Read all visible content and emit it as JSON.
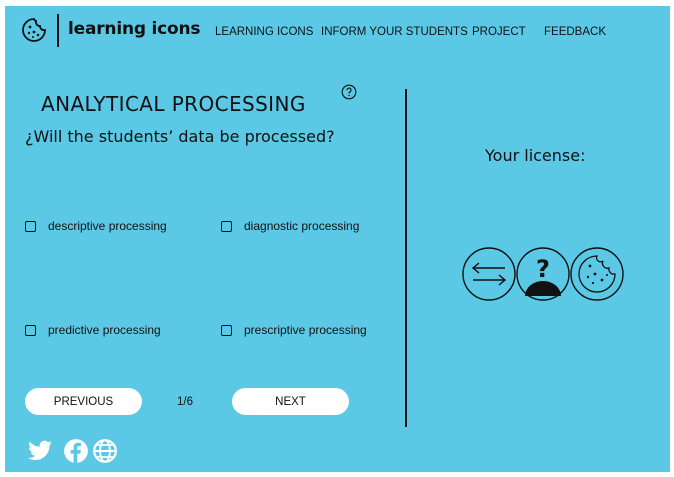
{
  "header": {
    "brand": "learning icons",
    "logo_icon": "cookie-icon",
    "nav": [
      {
        "label": "LEARNING ICONS"
      },
      {
        "label": "INFORM YOUR STUDENTS"
      },
      {
        "label": "PROJECT"
      },
      {
        "label": "FEEDBACK"
      }
    ]
  },
  "step": {
    "title": "ANALYTICAL PROCESSING",
    "help_icon": "question-circle-icon",
    "question": "¿Will the students’ data be processed?",
    "options": [
      {
        "label": "descriptive processing",
        "checked": false
      },
      {
        "label": "diagnostic processing",
        "checked": false
      },
      {
        "label": "predictive processing",
        "checked": false
      },
      {
        "label": "prescriptive processing",
        "checked": false
      }
    ],
    "previous_label": "PREVIOUS",
    "next_label": "NEXT",
    "page_indicator": "1/6"
  },
  "license": {
    "title": "Your license:",
    "icons": [
      "exchange-arrows-icon",
      "anonymous-person-icon",
      "cookie-icon"
    ]
  },
  "social": [
    "twitter-icon",
    "facebook-icon",
    "globe-icon"
  ],
  "colors": {
    "background": "#5bc8e6",
    "button": "#ffffff",
    "text": "#111111"
  }
}
